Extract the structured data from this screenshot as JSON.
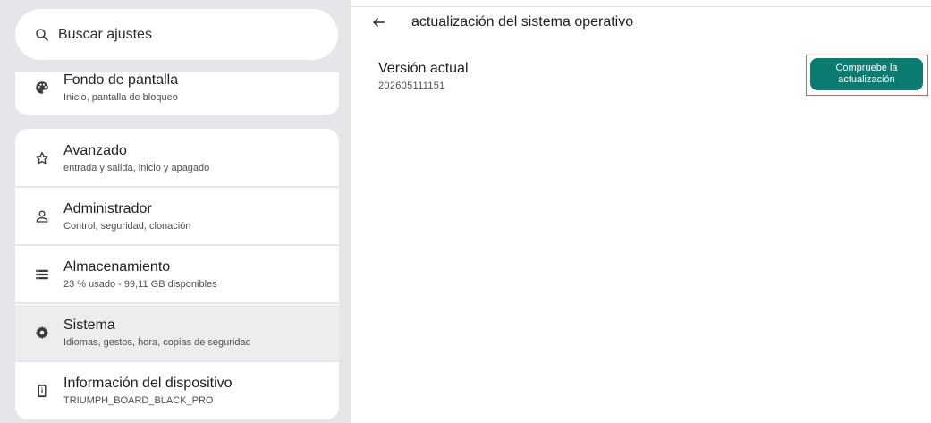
{
  "search": {
    "label": "Buscar ajustes"
  },
  "settings_items": [
    {
      "title": "Fondo de pantalla",
      "subtitle": "Inicio, pantalla de bloqueo",
      "icon": "palette-icon"
    },
    {
      "title": "Avanzado",
      "subtitle": "entrada y salida, inicio y apagado",
      "icon": "star-outline-icon"
    },
    {
      "title": "Administrador",
      "subtitle": "Control, seguridad, clonación",
      "icon": "person-icon"
    },
    {
      "title": "Almacenamiento",
      "subtitle": "23 % usado - 99,11 GB disponibles",
      "icon": "storage-icon"
    },
    {
      "title": "Sistema",
      "subtitle": "Idiomas, gestos, hora, copias de seguridad",
      "icon": "gear-icon",
      "selected": true
    },
    {
      "title": "Información del dispositivo",
      "subtitle": "TRIUMPH_BOARD_BLACK_PRO",
      "icon": "device-info-icon"
    }
  ],
  "detail": {
    "title": "actualización del sistema operativo",
    "version_label": "Versión actual",
    "version_value": "202605111151",
    "check_button_line1": "Compruebe la",
    "check_button_line2": "actualización"
  },
  "colors": {
    "accent": "#0b7a70",
    "sidebar_bg": "#e6e6ea",
    "selected_bg": "#ededf0",
    "highlight_frame": "#e05a5a"
  }
}
